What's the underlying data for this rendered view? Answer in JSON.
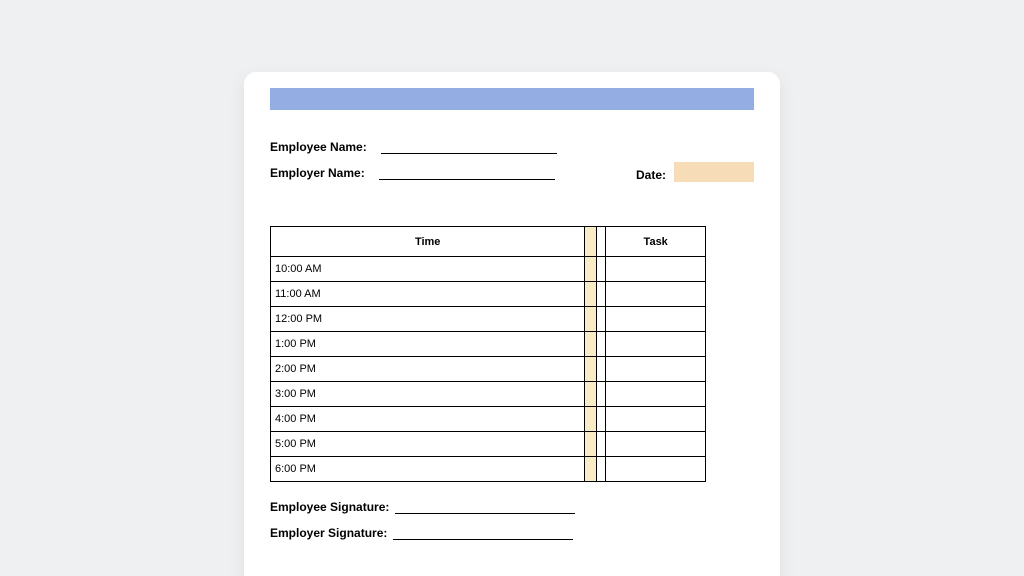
{
  "form": {
    "employee_name_label": "Employee Name:",
    "employer_name_label": "Employer Name:",
    "date_label": "Date:",
    "table_header_time": "Time",
    "table_header_task": "Task",
    "rows": [
      {
        "time": "10:00 AM",
        "task": ""
      },
      {
        "time": "11:00 AM",
        "task": ""
      },
      {
        "time": "12:00 PM",
        "task": ""
      },
      {
        "time": "1:00 PM",
        "task": ""
      },
      {
        "time": "2:00 PM",
        "task": ""
      },
      {
        "time": "3:00 PM",
        "task": ""
      },
      {
        "time": "4:00 PM",
        "task": ""
      },
      {
        "time": "5:00 PM",
        "task": ""
      },
      {
        "time": "6:00 PM",
        "task": ""
      }
    ],
    "employee_signature_label": "Employee Signature:",
    "employer_signature_label": "Employer Signature:"
  },
  "colors": {
    "banner": "#94aee3",
    "date_fill": "#f7dcb8",
    "gap_fill": "#f9ebc6"
  }
}
